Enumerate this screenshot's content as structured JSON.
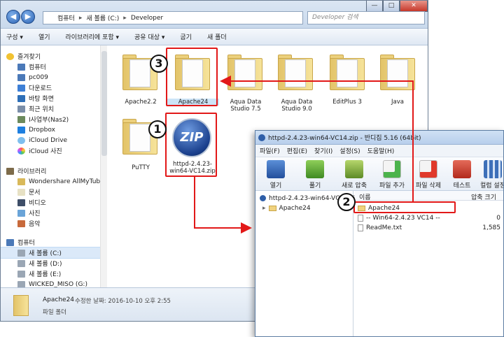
{
  "explorer": {
    "breadcrumb": [
      "컴퓨터",
      "새 볼륨 (C:)",
      "Developer"
    ],
    "search_placeholder": "Developer 검색",
    "toolbar": [
      "구성 ▾",
      "열기",
      "라이브러리에 포함 ▾",
      "공유 대상 ▾",
      "굽기",
      "새 폴더"
    ],
    "nav": {
      "favorites_header": "즐겨찾기",
      "favorites": [
        "컴퓨터",
        "pc009",
        "다운로드",
        "바탕 화면",
        "최근 위치",
        "I사업부(Nas2)",
        "Dropbox",
        "iCloud Drive",
        "iCloud 사진"
      ],
      "libraries_header": "라이브러리",
      "libraries": [
        "Wondershare AllMyTube",
        "문서",
        "비디오",
        "사진",
        "음악"
      ],
      "computer_header": "컴퓨터",
      "drives": [
        "새 볼륨 (C:)",
        "새 볼륨 (D:)",
        "새 볼륨 (E:)",
        "WICKED_MISO (G:)"
      ]
    },
    "files": [
      {
        "name": "Apache2.2"
      },
      {
        "name": "Apache24"
      },
      {
        "name": "Aqua Data Studio 7.5"
      },
      {
        "name": "Aqua Data Studio 9.0"
      },
      {
        "name": "EditPlus 3"
      },
      {
        "name": "Java"
      },
      {
        "name": "PuTTY"
      },
      {
        "name": "httpd-2.4.23-win64-VC14.zip"
      }
    ],
    "status": {
      "name": "Apache24",
      "meta": "수정한 날짜: 2016-10-10 오후 2:55",
      "type": "파일 폴더"
    }
  },
  "bandizip": {
    "title": "httpd-2.4.23-win64-VC14.zip - 반디집 5.16 (64bit)",
    "menu": [
      "파일(F)",
      "편집(E)",
      "찾기(I)",
      "설정(S)",
      "도움말(H)"
    ],
    "toolbar": [
      "열기",
      "풀기",
      "새로 압축",
      "파일 추가",
      "파일 삭제",
      "테스트",
      "컬럼 설정"
    ],
    "tree_root": "httpd-2.4.23-win64-VC14.zip",
    "tree_child": "Apache24",
    "col_name": "이름",
    "col_size": "압축 크기",
    "rows": [
      {
        "name": "Apache24",
        "size": ""
      },
      {
        "name": "-- Win64-2.4.23 VC14 --",
        "size": "0"
      },
      {
        "name": "ReadMe.txt",
        "size": "1,585"
      }
    ]
  },
  "callouts": [
    "1",
    "2",
    "3"
  ],
  "colors": {
    "annotation": "#e21818",
    "folder": "#f0d27e"
  }
}
